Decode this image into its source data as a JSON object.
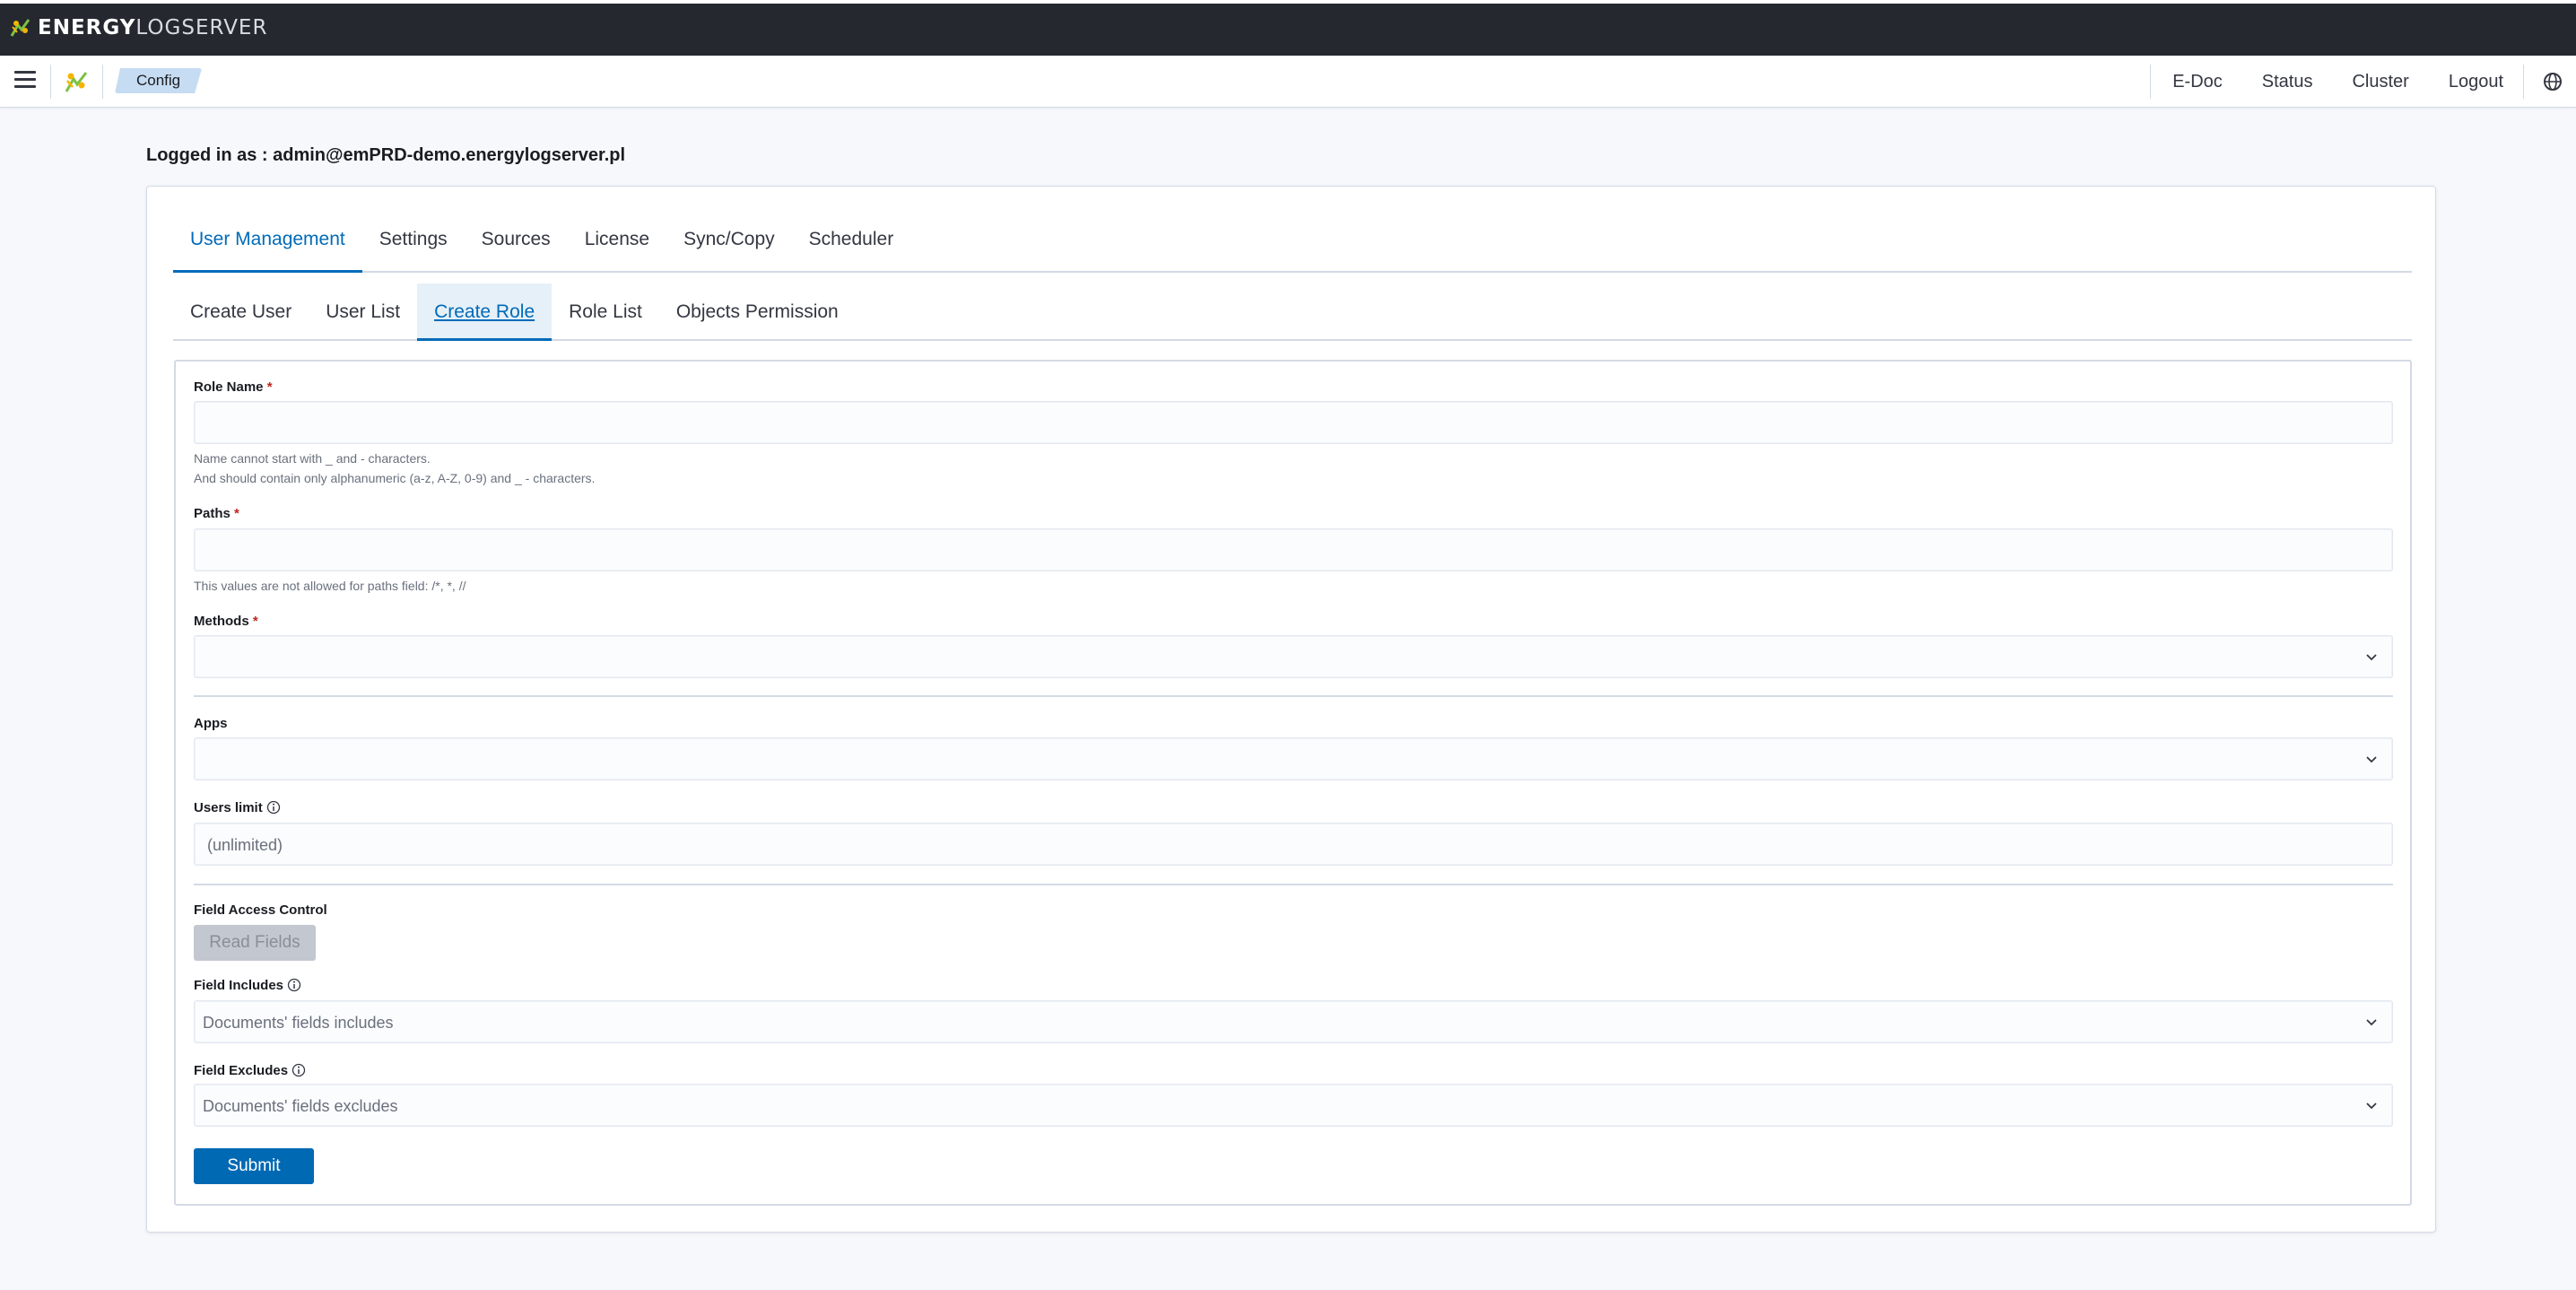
{
  "brand": {
    "name_bold": "ENERGY",
    "name_light": "LOGSERVER"
  },
  "header": {
    "breadcrumb": "Config",
    "links": [
      "E-Doc",
      "Status",
      "Cluster",
      "Logout"
    ]
  },
  "logged_in": "Logged in as : admin@emPRD-demo.energylogserver.pl",
  "tabs": [
    "User Management",
    "Settings",
    "Sources",
    "License",
    "Sync/Copy",
    "Scheduler"
  ],
  "subtabs": [
    "Create User",
    "User List",
    "Create Role",
    "Role List",
    "Objects Permission"
  ],
  "form": {
    "role_name": {
      "label": "Role Name",
      "required": "*",
      "help1": "Name cannot start with _ and - characters.",
      "help2": "And should contain only alphanumeric (a-z, A-Z, 0-9) and _ - characters."
    },
    "paths": {
      "label": "Paths",
      "required": "*",
      "help": "This values are not allowed for paths field: /*, *, //"
    },
    "methods": {
      "label": "Methods",
      "required": "*"
    },
    "apps": {
      "label": "Apps"
    },
    "users_limit": {
      "label": "Users limit",
      "value": "(unlimited)"
    },
    "field_access_control": {
      "label": "Field Access Control",
      "button": "Read Fields"
    },
    "field_includes": {
      "label": "Field Includes",
      "placeholder": "Documents' fields includes"
    },
    "field_excludes": {
      "label": "Field Excludes",
      "placeholder": "Documents' fields excludes"
    },
    "submit": "Submit"
  },
  "colors": {
    "accent": "#006bb8",
    "topbar": "#25282f",
    "required": "#bd271e",
    "submit": "#0069b4"
  },
  "icons": [
    "menu-icon",
    "app-logo-icon",
    "chevron-down-icon",
    "info-icon",
    "globe-icon"
  ]
}
